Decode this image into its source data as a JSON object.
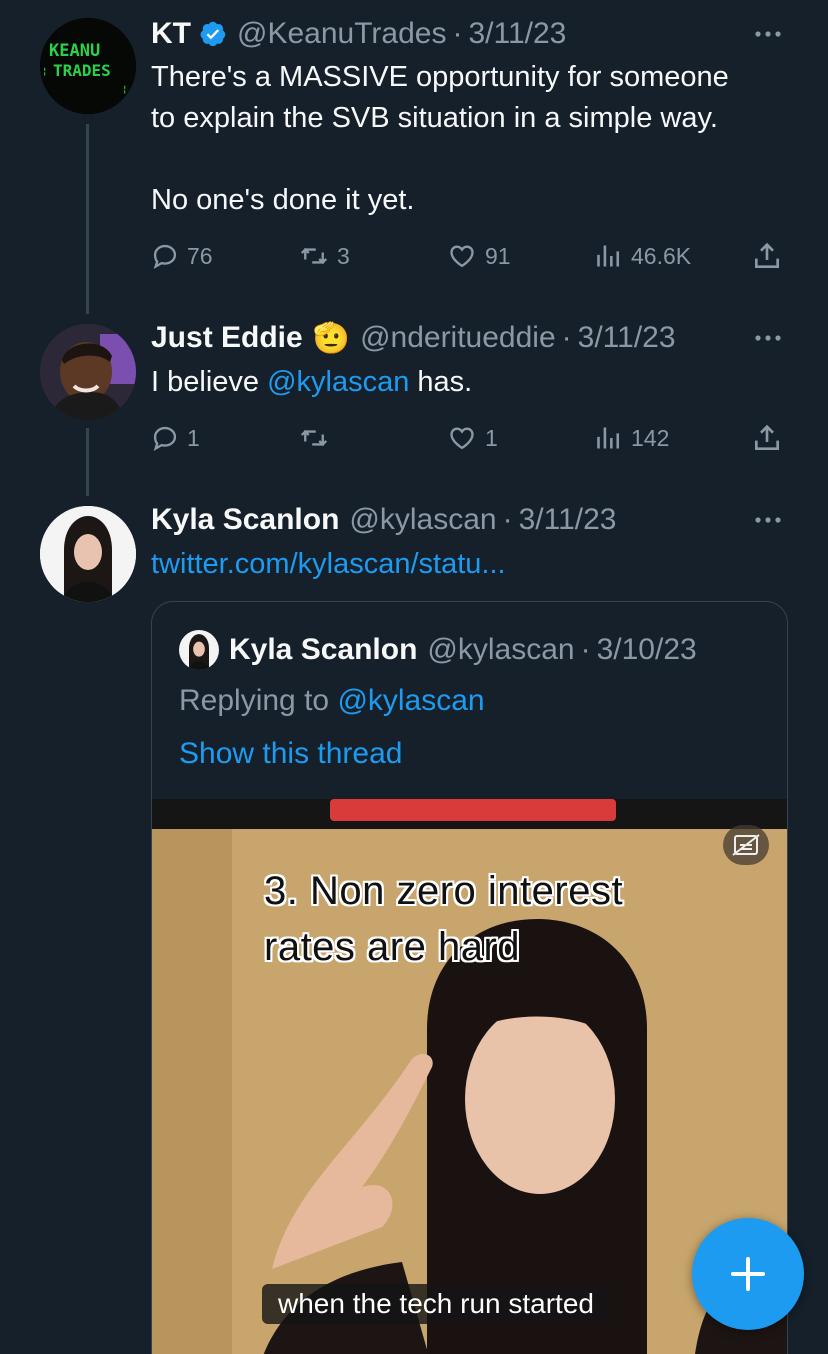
{
  "tweets": [
    {
      "name": "KT",
      "handle": "@KeanuTrades",
      "date": "3/11/23",
      "avatar_text": "KEANU TRADES",
      "text": "There's a MASSIVE opportunity for someone\nto explain the SVB situation in a simple way.\n\nNo one's done it yet.",
      "replies": "76",
      "retweets": "3",
      "likes": "91",
      "views": "46.6K"
    },
    {
      "name": "Just Eddie",
      "handle": "@nderitueddie",
      "date": "3/11/23",
      "name_emoji": "🫡",
      "text_before": "I believe ",
      "mention": "@kylascan",
      "text_after": " has.",
      "replies": "1",
      "retweets": "",
      "likes": "1",
      "views": "142"
    },
    {
      "name": "Kyla Scanlon",
      "handle": "@kylascan",
      "date": "3/11/23",
      "link": "twitter.com/kylascan/statu..."
    }
  ],
  "quote": {
    "name": "Kyla Scanlon",
    "handle": "@kylascan",
    "date": "3/10/23",
    "replying_label": "Replying to ",
    "replying_handle": "@kylascan",
    "show_thread": "Show this thread",
    "video": {
      "overlay_line1": "3. Non zero interest",
      "overlay_line2": "rates are hard",
      "caption": "when the tech run started"
    }
  },
  "separator": "·",
  "colors": {
    "background": "#15202b",
    "accent": "#1d9bf0",
    "muted": "#8b98a5",
    "border": "#38444d"
  },
  "icons": [
    "verified-badge-icon",
    "more-icon",
    "reply-icon",
    "retweet-icon",
    "like-icon",
    "views-icon",
    "share-icon",
    "captions-icon",
    "compose-plus-icon"
  ]
}
